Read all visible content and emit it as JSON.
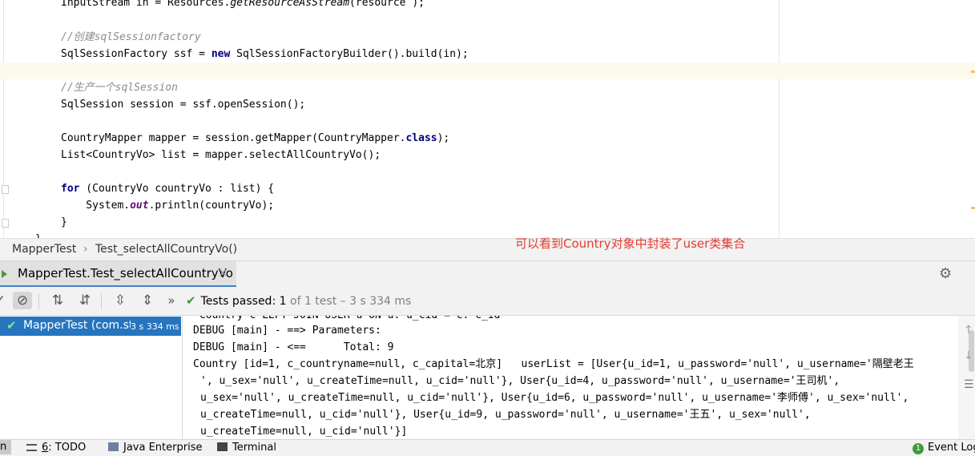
{
  "editor": {
    "lines": {
      "l0": {
        "a": "InputStream in = Resources.",
        "b": "getResourceAsStream",
        "c": "(resource );"
      },
      "l1": "//创建sqlSessionfactory",
      "l2": {
        "a": "SqlSessionFactory ssf = ",
        "kw": "new",
        "b": " SqlSessionFactoryBuilder().build(in);"
      },
      "l3": "//生产一个sqlSession",
      "l4": "SqlSession session = ssf.openSession();",
      "l5": {
        "a": "CountryMapper mapper = session.getMapper(CountryMapper.",
        "kw": "class",
        "b": ");"
      },
      "l6": "List<CountryVo> list = mapper.selectAllCountryVo();",
      "l7": {
        "kw": "for",
        "a": " (CountryVo countryVo : list) {"
      },
      "l8": {
        "a": "    System.",
        "st": "out",
        "b": ".println(countryVo);"
      },
      "l9": "}",
      "l10": "}"
    }
  },
  "breadcrumb": {
    "class_name": "MapperTest",
    "separator": "›",
    "method_name": "Test_selectAllCountryVo()"
  },
  "annotation": "可以看到Country对象中封装了user类集合",
  "run_panel": {
    "tab_label": "MapperTest.Test_selectAllCountryVo",
    "close_glyph": "×",
    "tests_passed_label": "Tests passed:",
    "passed_count": "1",
    "summary": "of 1 test – 3 s 334 ms"
  },
  "toolbar_glyphs": {
    "more": "»"
  },
  "test_tree": {
    "item_name": "MapperTest (com.st",
    "item_time": "3 s 334 ms"
  },
  "console": {
    "cut_line": " Country c LEFT JOIN USER u ON u. u_cid = c. c_id",
    "lines": [
      "DEBUG [main] - ==> Parameters: ",
      "DEBUG [main] - <==      Total: 9",
      "Country [id=1, c_countryname=null, c_capital=北京]   userList = [User{u_id=1, u_password='null', u_username='隔壁老王",
      "', u_sex='null', u_createTime=null, u_cid='null'}, User{u_id=4, u_password='null', u_username='王司机',",
      "u_sex='null', u_createTime=null, u_cid='null'}, User{u_id=6, u_password='null', u_username='李师傅', u_sex='null',",
      "u_createTime=null, u_cid='null'}, User{u_id=9, u_password='null', u_username='王五', u_sex='null',",
      "u_createTime=null, u_cid='null'}]"
    ]
  },
  "status_bar": {
    "left_cut": "n",
    "todo_mnemonic": "6",
    "todo_label": ": TODO",
    "java_enterprise": "Java Enterprise",
    "terminal": "Terminal",
    "event_count": "1",
    "event_log": "Event Log"
  },
  "colors": {
    "accent": "#2675bf",
    "annotation": "#e53a2f",
    "pass": "#3c9a3c"
  }
}
